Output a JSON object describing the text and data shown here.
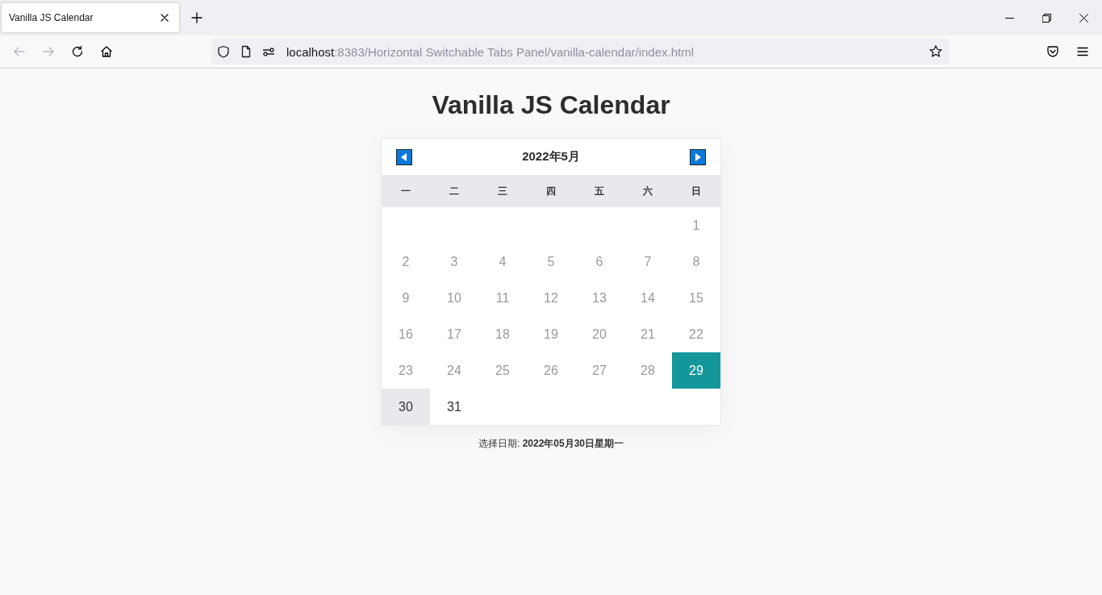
{
  "browser": {
    "tabs": [
      {
        "title": "Vanilla JS Calendar",
        "selected": true
      }
    ],
    "toolbar": {
      "back": {
        "disabled": true
      },
      "forward": {
        "disabled": true
      }
    },
    "address_bar": {
      "host": "localhost",
      "path": ":8383/Horizontal Switchable Tabs Panel/vanilla-calendar/index.html"
    }
  },
  "page": {
    "title": "Vanilla JS Calendar"
  },
  "calendar": {
    "month_title": "2022年5月",
    "weekdays": [
      "一",
      "二",
      "三",
      "四",
      "五",
      "六",
      "日"
    ],
    "weeks": [
      [
        {
          "kind": "empty"
        },
        {
          "kind": "empty"
        },
        {
          "kind": "empty"
        },
        {
          "kind": "empty"
        },
        {
          "kind": "empty"
        },
        {
          "kind": "empty"
        },
        {
          "kind": "day",
          "label": "1",
          "disabled": true,
          "today": false,
          "selected": false
        }
      ],
      [
        {
          "kind": "day",
          "label": "2",
          "disabled": true,
          "today": false,
          "selected": false
        },
        {
          "kind": "day",
          "label": "3",
          "disabled": true,
          "today": false,
          "selected": false
        },
        {
          "kind": "day",
          "label": "4",
          "disabled": true,
          "today": false,
          "selected": false
        },
        {
          "kind": "day",
          "label": "5",
          "disabled": true,
          "today": false,
          "selected": false
        },
        {
          "kind": "day",
          "label": "6",
          "disabled": true,
          "today": false,
          "selected": false
        },
        {
          "kind": "day",
          "label": "7",
          "disabled": true,
          "today": false,
          "selected": false
        },
        {
          "kind": "day",
          "label": "8",
          "disabled": true,
          "today": false,
          "selected": false
        }
      ],
      [
        {
          "kind": "day",
          "label": "9",
          "disabled": true,
          "today": false,
          "selected": false
        },
        {
          "kind": "day",
          "label": "10",
          "disabled": true,
          "today": false,
          "selected": false
        },
        {
          "kind": "day",
          "label": "11",
          "disabled": true,
          "today": false,
          "selected": false
        },
        {
          "kind": "day",
          "label": "12",
          "disabled": true,
          "today": false,
          "selected": false
        },
        {
          "kind": "day",
          "label": "13",
          "disabled": true,
          "today": false,
          "selected": false
        },
        {
          "kind": "day",
          "label": "14",
          "disabled": true,
          "today": false,
          "selected": false
        },
        {
          "kind": "day",
          "label": "15",
          "disabled": true,
          "today": false,
          "selected": false
        }
      ],
      [
        {
          "kind": "day",
          "label": "16",
          "disabled": true,
          "today": false,
          "selected": false
        },
        {
          "kind": "day",
          "label": "17",
          "disabled": true,
          "today": false,
          "selected": false
        },
        {
          "kind": "day",
          "label": "18",
          "disabled": true,
          "today": false,
          "selected": false
        },
        {
          "kind": "day",
          "label": "19",
          "disabled": true,
          "today": false,
          "selected": false
        },
        {
          "kind": "day",
          "label": "20",
          "disabled": true,
          "today": false,
          "selected": false
        },
        {
          "kind": "day",
          "label": "21",
          "disabled": true,
          "today": false,
          "selected": false
        },
        {
          "kind": "day",
          "label": "22",
          "disabled": true,
          "today": false,
          "selected": false
        }
      ],
      [
        {
          "kind": "day",
          "label": "23",
          "disabled": true,
          "today": false,
          "selected": false
        },
        {
          "kind": "day",
          "label": "24",
          "disabled": true,
          "today": false,
          "selected": false
        },
        {
          "kind": "day",
          "label": "25",
          "disabled": true,
          "today": false,
          "selected": false
        },
        {
          "kind": "day",
          "label": "26",
          "disabled": true,
          "today": false,
          "selected": false
        },
        {
          "kind": "day",
          "label": "27",
          "disabled": true,
          "today": false,
          "selected": false
        },
        {
          "kind": "day",
          "label": "28",
          "disabled": true,
          "today": false,
          "selected": false
        },
        {
          "kind": "day",
          "label": "29",
          "disabled": false,
          "today": true,
          "selected": false
        }
      ],
      [
        {
          "kind": "day",
          "label": "30",
          "disabled": false,
          "today": false,
          "selected": true
        },
        {
          "kind": "day",
          "label": "31",
          "disabled": false,
          "today": false,
          "selected": false
        },
        {
          "kind": "empty"
        },
        {
          "kind": "empty"
        },
        {
          "kind": "empty"
        },
        {
          "kind": "empty"
        },
        {
          "kind": "empty"
        }
      ]
    ]
  },
  "selected_date": {
    "text": "选择日期: **2022年05月30日星期一**"
  }
}
